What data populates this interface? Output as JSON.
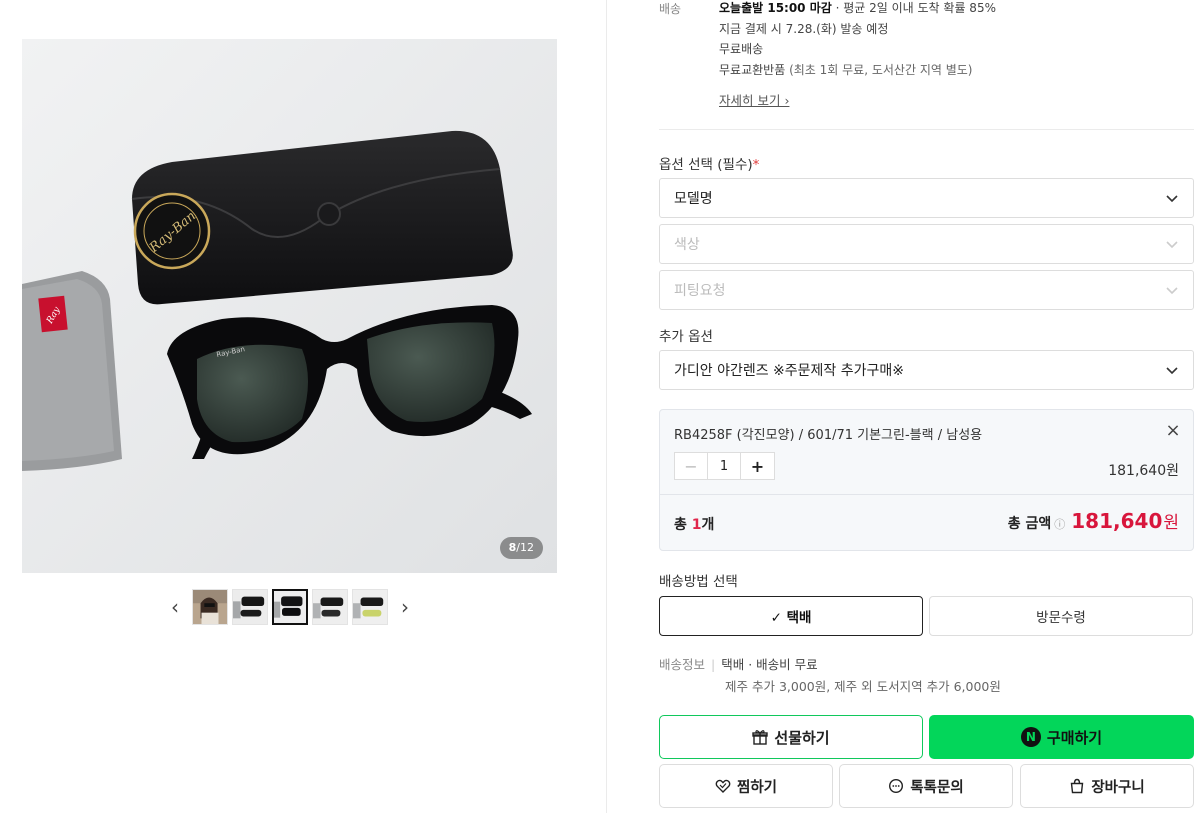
{
  "gallery": {
    "counter_current": "8",
    "counter_sep": "/",
    "counter_total": "12",
    "prev_arrow": "‹",
    "next_arrow": "›",
    "thumbnail_count": 5,
    "active_thumbnail": 3
  },
  "shipping": {
    "label": "배송",
    "line1_bold": "오늘출발 15:00 마감",
    "line1_rest": " · 평균 2일 이내 도착 확률 85%",
    "line2": "지금 결제 시 7.28.(화) 발송 예정",
    "line3": "무료배송",
    "line4_main": "무료교환반품",
    "line4_sub": " (최초 1회 무료, 도서산간 지역 별도)",
    "detail_link": "자세히 보기 ›"
  },
  "options": {
    "title": "옵션 선택 (필수)",
    "required_mark": "*",
    "select1": "모델명",
    "select2": "색상",
    "select3": "피팅요청",
    "extra_title": "추가 옵션",
    "extra_select": "가디안 야간렌즈 ※주문제작 추가구매※"
  },
  "selected_item": {
    "name": "RB4258F (각진모양) / 601/71 기본그린-블랙 / 남성용",
    "close": "×",
    "minus": "−",
    "quantity": "1",
    "plus": "+",
    "price": "181,640원"
  },
  "total": {
    "count_prefix": "총 ",
    "count_value": "1",
    "count_suffix": "개",
    "label": "총 금액",
    "info_icon": "ⓘ",
    "amount": "181,640",
    "currency": "원"
  },
  "delivery": {
    "title": "배송방법 선택",
    "option1": "✓ 택배",
    "option2": "방문수령",
    "info_label": "배송정보",
    "info_sep": "|",
    "info_value": "택배 · 배송비 무료",
    "info_extra": "제주 추가 3,000원, 제주 외 도서지역 추가 6,000원"
  },
  "actions": {
    "gift": "선물하기",
    "buy_badge": "N",
    "buy": "구매하기",
    "wish": "찜하기",
    "talk": "톡톡문의",
    "cart": "장바구니"
  },
  "colors": {
    "buy_green": "#03d65a",
    "price_red": "#d8163c",
    "required_red": "#e03a3a"
  }
}
